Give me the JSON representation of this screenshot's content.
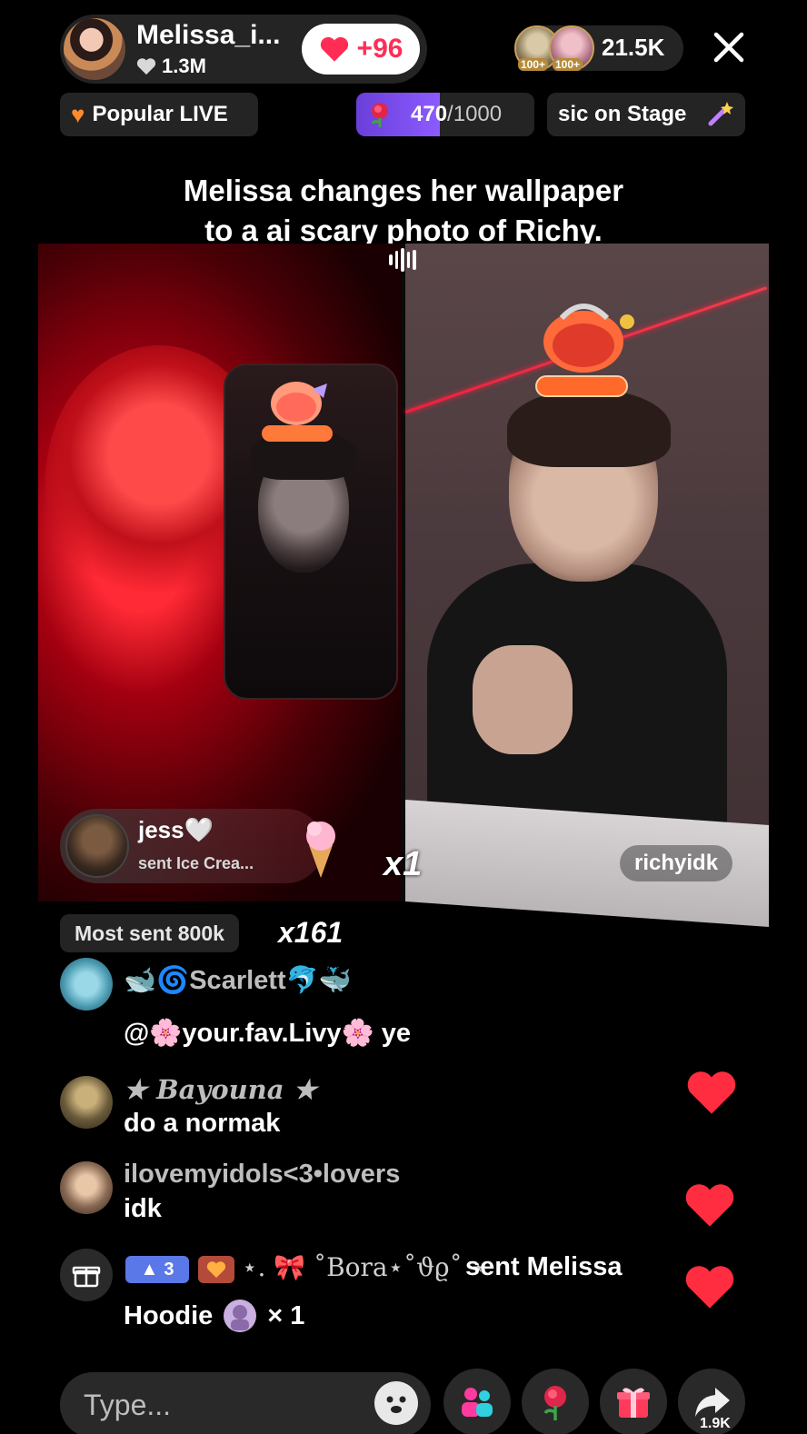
{
  "header": {
    "host_name": "Melissa_i...",
    "host_likes": "1.3M",
    "like_boost": "+96",
    "viewer_badges": [
      "100+",
      "100+"
    ],
    "viewer_count": "21.5K"
  },
  "top_row": {
    "popular_label": "Popular LIVE",
    "goal_current": "470",
    "goal_total": "/1000",
    "goal_progress": 0.47,
    "stage_label": "sic on Stage"
  },
  "caption": {
    "line1": "Melissa changes her wallpaper",
    "line2": "to a ai scary photo of Richy."
  },
  "battle": {
    "gift_user": "jess🤍",
    "gift_message": "sent Ice Crea...",
    "gift_multiplier": "x1",
    "right_streamer": "richyidk"
  },
  "most_sent": {
    "label": "Most sent 800k",
    "multiplier": "x161"
  },
  "comments": [
    {
      "user": "🐋🌀Scarlett🐬🐳",
      "text": "@🌸your.fav.Livy🌸 ye"
    },
    {
      "user": "★ 𝑩𝒂𝒚𝒐𝒖𝒏𝒂 ★",
      "text": "do a normak"
    },
    {
      "user": "ilovemyidols<3•lovers",
      "text": "idk"
    }
  ],
  "gift_event": {
    "level": "3",
    "user": "⋆. 🎀 ˚Bora⋆˚ϑϱ˚ ⋆",
    "line1_suffix": "sent Melissa",
    "gift_name": "Hoodie",
    "gift_count": "× 1"
  },
  "bottom_bar": {
    "placeholder": "Type...",
    "share_count": "1.9K"
  },
  "colors": {
    "accent_red": "#ff2d55",
    "goal_purple": "#6a3fd9",
    "level_blue": "#5a78e8"
  }
}
